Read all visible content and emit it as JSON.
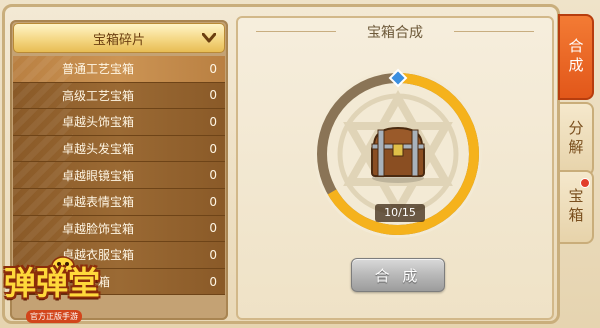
{
  "left_panel": {
    "dropdown_label": "宝箱碎片",
    "items": [
      {
        "name": "普通工艺宝箱",
        "count": "0"
      },
      {
        "name": "高级工艺宝箱",
        "count": "0"
      },
      {
        "name": "卓越头饰宝箱",
        "count": "0"
      },
      {
        "name": "卓越头发宝箱",
        "count": "0"
      },
      {
        "name": "卓越眼镜宝箱",
        "count": "0"
      },
      {
        "name": "卓越表情宝箱",
        "count": "0"
      },
      {
        "name": "卓越脸饰宝箱",
        "count": "0"
      },
      {
        "name": "卓越衣服宝箱",
        "count": "0"
      },
      {
        "name": "宝箱",
        "count": "0"
      }
    ]
  },
  "right_panel": {
    "title": "宝箱合成",
    "progress_text": "10/15",
    "progress_fraction": 0.6667,
    "compose_button": "合 成"
  },
  "tabs": {
    "compose": "合成",
    "decompose": "分解",
    "chest": "宝箱"
  },
  "logo": {
    "title": "弹弹堂",
    "subtitle": "官方正版手游"
  },
  "colors": {
    "progress": "#f5b21c",
    "progress_track": "#8a7456",
    "active_tab": "#e2571a"
  }
}
